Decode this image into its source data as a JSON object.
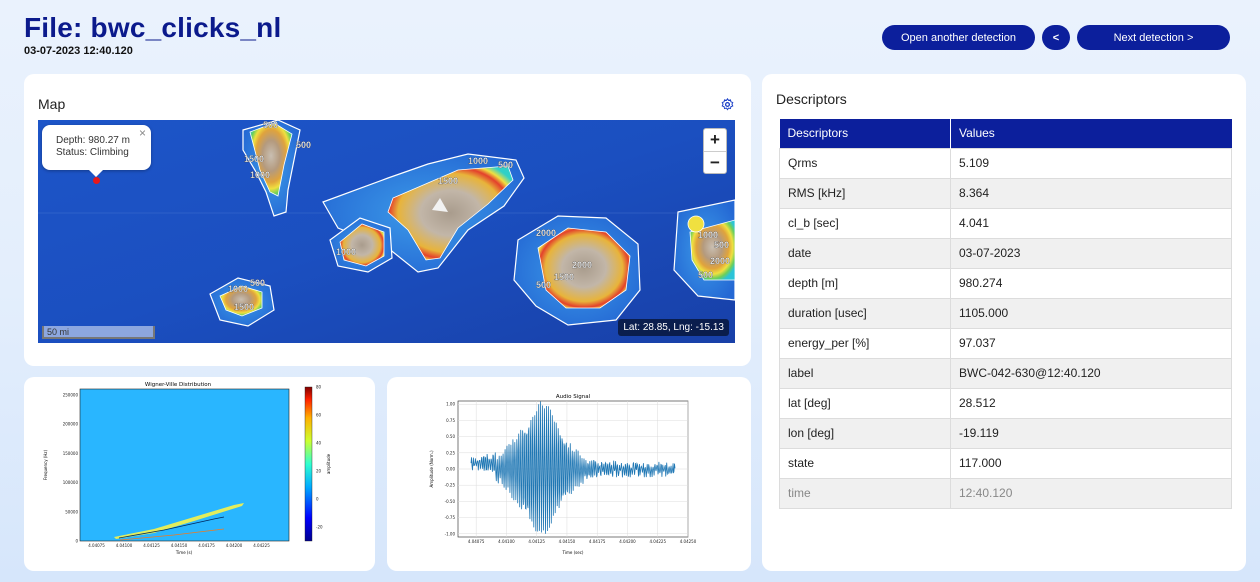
{
  "header": {
    "title": "File: bwc_clicks_nl",
    "datetime": "03-07-2023 12:40.120"
  },
  "buttons": {
    "open_another": "Open another detection",
    "prev": "<",
    "next": "Next detection >"
  },
  "map": {
    "title": "Map",
    "settings_icon": "gear-icon",
    "popup": {
      "depth": "Depth: 980.27 m",
      "status": "Status: Climbing",
      "close": "×"
    },
    "zoom_in": "+",
    "zoom_out": "−",
    "scale": "50 mi",
    "coords": "Lat: 28.85, Lng: -15.13",
    "contour_labels": [
      "500",
      "1500",
      "1000",
      "500",
      "1000",
      "500",
      "1500",
      "2000",
      "1000",
      "2000",
      "1500",
      "500",
      "1000",
      "500",
      "1500",
      "1000",
      "500",
      "2000",
      "500"
    ]
  },
  "descriptors": {
    "title": "Descriptors",
    "columns": [
      "Descriptors",
      "Values"
    ],
    "rows": [
      {
        "key": "Qrms",
        "value": "5.109"
      },
      {
        "key": "RMS [kHz]",
        "value": "8.364"
      },
      {
        "key": "cl_b [sec]",
        "value": "4.041"
      },
      {
        "key": "date",
        "value": "03-07-2023"
      },
      {
        "key": "depth [m]",
        "value": "980.274"
      },
      {
        "key": "duration [usec]",
        "value": "1105.000"
      },
      {
        "key": "energy_per [%]",
        "value": "97.037"
      },
      {
        "key": "label",
        "value": "BWC-042-630@12:40.120"
      },
      {
        "key": "lat [deg]",
        "value": "28.512"
      },
      {
        "key": "lon [deg]",
        "value": "-19.119"
      },
      {
        "key": "state",
        "value": "117.000"
      },
      {
        "key": "time",
        "value": "12:40.120"
      }
    ]
  },
  "chart_data": [
    {
      "type": "heatmap",
      "title": "Wigner-Ville Distribution",
      "xlabel": "Time (s)",
      "ylabel": "Frequency (Hz)",
      "colorbar_label": "amplitude",
      "x_ticks": [
        "4.04075",
        "4.04100",
        "4.04125",
        "4.04150",
        "4.04175",
        "4.04200",
        "4.04225"
      ],
      "y_ticks": [
        "0",
        "50000",
        "100000",
        "150000",
        "200000",
        "250000"
      ],
      "colorbar_ticks": [
        "80",
        "60",
        "40",
        "20",
        "0",
        "-20"
      ],
      "xlim": [
        4.0406,
        4.0425
      ],
      "ylim": [
        0,
        260000
      ],
      "clim": [
        -30,
        80
      ]
    },
    {
      "type": "line",
      "title": "Audio Signal",
      "xlabel": "Time (sec)",
      "ylabel": "Amplitude (Norm.)",
      "x_ticks": [
        "4.04075",
        "4.04100",
        "4.04125",
        "4.04150",
        "4.04175",
        "4.04200",
        "4.04225",
        "4.04250"
      ],
      "y_ticks": [
        "1.00",
        "0.75",
        "0.50",
        "0.25",
        "0.00",
        "-0.25",
        "-0.50",
        "-0.75",
        "-1.00"
      ],
      "xlim": [
        4.0406,
        4.0425
      ],
      "ylim": [
        -1.05,
        1.05
      ],
      "grid": true,
      "color": "#1f77b4"
    }
  ]
}
